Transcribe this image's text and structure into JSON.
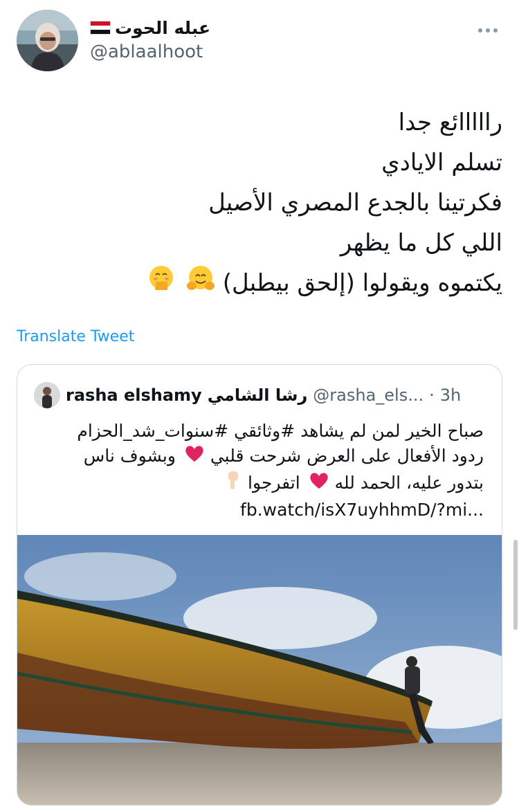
{
  "tweet": {
    "author": {
      "display_name": "عبله الحوت",
      "flag_icon": "egypt-flag-icon",
      "handle": "@ablaalhoot"
    },
    "more_icon": "ellipsis-icon",
    "lines": [
      "رااااائع جدا",
      "تسلم الايادي",
      "فكرتينا بالجدع المصري الأصيل",
      "اللي كل ما يظهر",
      "يكتموه ويقولوا (إلحق بيطبل)"
    ],
    "line_emojis": [
      "hugging-face-emoji",
      "face-with-hand-over-mouth-emoji"
    ],
    "translate_label": "Translate Tweet"
  },
  "quote": {
    "name_en": "rasha elshamy",
    "name_ar": "رشا الشامي",
    "handle": "@rasha_els...",
    "separator": "·",
    "time": "3h",
    "lines": [
      "صباح الخير لمن لم يشاهد #وثائقي #سنوات_شد_الحزام",
      "ردود الأفعال على العرض شرحت قلبي",
      "وبشوف ناس",
      "بتدور عليه، الحمد لله",
      "اتفرجوا"
    ],
    "link": "fb.watch/isX7uyhhmD/?mi...",
    "emojis": [
      "red-heart-emoji",
      "red-heart-emoji",
      "backhand-index-pointing-down-emoji"
    ],
    "image_icon": "boat-on-beach-photo"
  },
  "colors": {
    "link_blue": "#1d9bf0",
    "secondary_gray": "#536471",
    "border": "#cfd9de",
    "heart_red": "#e0245e"
  }
}
